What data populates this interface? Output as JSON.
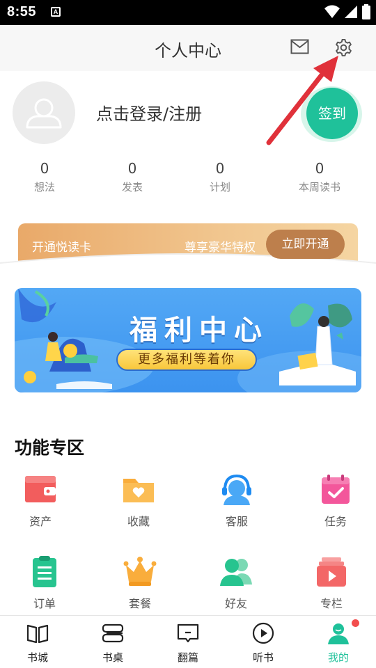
{
  "status": {
    "time": "8:55",
    "notif_letter": "A"
  },
  "header": {
    "title": "个人中心"
  },
  "profile": {
    "login_text": "点击登录/注册",
    "signin_label": "签到"
  },
  "stats": [
    {
      "value": "0",
      "label": "想法"
    },
    {
      "value": "0",
      "label": "发表"
    },
    {
      "value": "0",
      "label": "计划"
    },
    {
      "value": "0",
      "label": "本周读书"
    }
  ],
  "vip": {
    "left_text": "开通悦读卡",
    "mid_text": "尊享豪华特权",
    "button_label": "立即开通"
  },
  "banner": {
    "title": "福利中心",
    "subtitle": "更多福利等着你"
  },
  "functions": {
    "section_title": "功能专区",
    "items": [
      {
        "label": "资产",
        "icon": "wallet-icon"
      },
      {
        "label": "收藏",
        "icon": "folder-heart-icon"
      },
      {
        "label": "客服",
        "icon": "headset-icon"
      },
      {
        "label": "任务",
        "icon": "calendar-check-icon"
      },
      {
        "label": "订单",
        "icon": "clipboard-icon"
      },
      {
        "label": "套餐",
        "icon": "crown-icon"
      },
      {
        "label": "好友",
        "icon": "friends-icon"
      },
      {
        "label": "专栏",
        "icon": "play-column-icon"
      }
    ]
  },
  "bottom_nav": [
    {
      "label": "书城",
      "icon": "book-icon"
    },
    {
      "label": "书桌",
      "icon": "desk-icon"
    },
    {
      "label": "翻篇",
      "icon": "page-icon"
    },
    {
      "label": "听书",
      "icon": "play-circle-icon"
    },
    {
      "label": "我的",
      "icon": "profile-icon",
      "active": true
    }
  ],
  "colors": {
    "accent": "#1fc19a",
    "vip_button": "#bd7f4c",
    "banner_blue": "#3c93ef",
    "arrow_red": "#e0313a",
    "badge_red": "#f24e4e"
  }
}
